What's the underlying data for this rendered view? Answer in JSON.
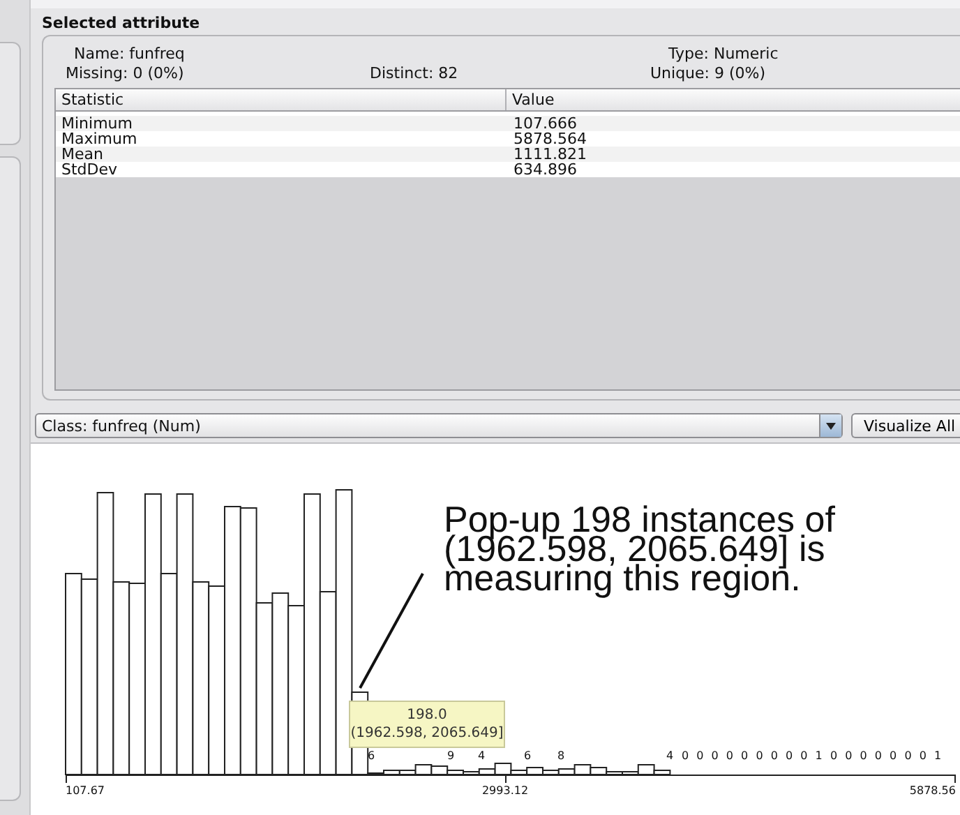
{
  "panel": {
    "title": "Selected attribute"
  },
  "attribute": {
    "name": "Name: funfreq",
    "type": "Type: Numeric",
    "missing": "Missing: 0 (0%)",
    "distinct": "Distinct: 82",
    "unique": "Unique: 9 (0%)"
  },
  "table": {
    "columns": [
      "Statistic",
      "Value"
    ],
    "rows": [
      {
        "statistic": "Minimum",
        "value": "107.666"
      },
      {
        "statistic": "Maximum",
        "value": "5878.564"
      },
      {
        "statistic": "Mean",
        "value": "1111.821"
      },
      {
        "statistic": "StdDev",
        "value": "634.896"
      }
    ]
  },
  "class_selector": {
    "value": "Class: funfreq (Num)"
  },
  "buttons": [
    "Visualize All"
  ],
  "histogram": {
    "bar_labels": [
      "6",
      "9",
      "4",
      "6",
      "8",
      "4",
      "0",
      "0",
      "0",
      "0",
      "0",
      "0",
      "0",
      "0",
      "0",
      "1",
      "0",
      "0",
      "0",
      "0",
      "0",
      "0",
      "0",
      "1"
    ],
    "axis_labels": [
      "107.67",
      "2993.12",
      "5878.56"
    ],
    "tooltip": "198.0\n(1962.598, 2065.649]"
  },
  "annotation": "Pop-up 198 instances of\n(1962.598, 2065.649] is\nmeasuring this region."
}
